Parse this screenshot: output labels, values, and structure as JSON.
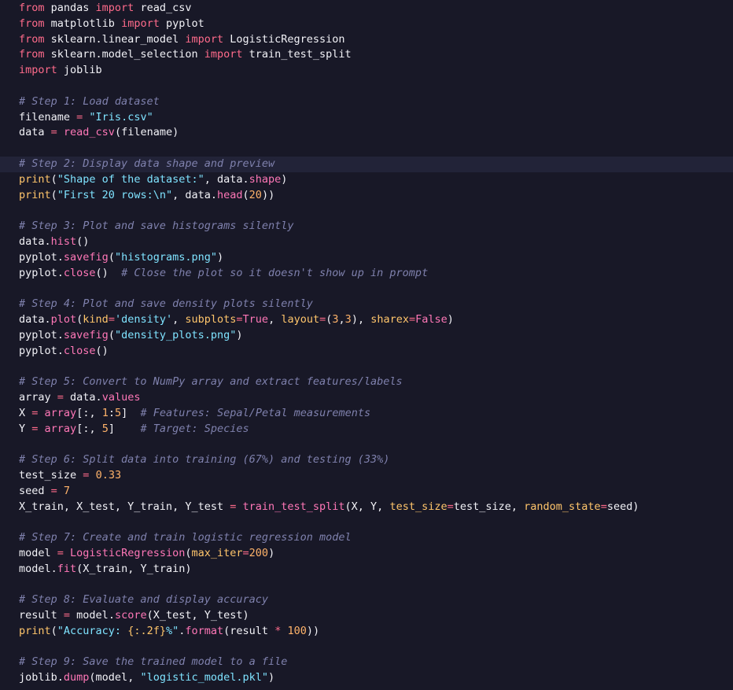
{
  "editor": {
    "lines": [
      [
        {
          "t": "from",
          "c": "kw"
        },
        {
          "t": " pandas ",
          "c": "id"
        },
        {
          "t": "import",
          "c": "kw"
        },
        {
          "t": " read_csv",
          "c": "id"
        }
      ],
      [
        {
          "t": "from",
          "c": "kw"
        },
        {
          "t": " matplotlib ",
          "c": "id"
        },
        {
          "t": "import",
          "c": "kw"
        },
        {
          "t": " pyplot",
          "c": "id"
        }
      ],
      [
        {
          "t": "from",
          "c": "kw"
        },
        {
          "t": " sklearn.linear_model ",
          "c": "id"
        },
        {
          "t": "import",
          "c": "kw"
        },
        {
          "t": " LogisticRegression",
          "c": "id"
        }
      ],
      [
        {
          "t": "from",
          "c": "kw"
        },
        {
          "t": " sklearn.model_selection ",
          "c": "id"
        },
        {
          "t": "import",
          "c": "kw"
        },
        {
          "t": " train_test_split",
          "c": "id"
        }
      ],
      [
        {
          "t": "import",
          "c": "kw"
        },
        {
          "t": " joblib",
          "c": "id"
        }
      ],
      [],
      [
        {
          "t": "# Step 1: Load dataset",
          "c": "cm"
        }
      ],
      [
        {
          "t": "filename ",
          "c": "id"
        },
        {
          "t": "=",
          "c": "op"
        },
        {
          "t": " \"Iris.csv\"",
          "c": "str"
        }
      ],
      [
        {
          "t": "data ",
          "c": "id"
        },
        {
          "t": "=",
          "c": "op"
        },
        {
          "t": " read_csv",
          "c": "fn"
        },
        {
          "t": "(filename)",
          "c": "pun"
        }
      ],
      [],
      [
        {
          "t": "# Step 2: Display data shape and preview",
          "c": "cm"
        }
      ],
      [
        {
          "t": "print",
          "c": "param"
        },
        {
          "t": "(",
          "c": "pun"
        },
        {
          "t": "\"Shape of the dataset:\"",
          "c": "str"
        },
        {
          "t": ", data.",
          "c": "pun"
        },
        {
          "t": "shape",
          "c": "fn"
        },
        {
          "t": ")",
          "c": "pun"
        }
      ],
      [
        {
          "t": "print",
          "c": "param"
        },
        {
          "t": "(",
          "c": "pun"
        },
        {
          "t": "\"First 20 rows:",
          "c": "str"
        },
        {
          "t": "\\n",
          "c": "esc"
        },
        {
          "t": "\"",
          "c": "str"
        },
        {
          "t": ", data.",
          "c": "pun"
        },
        {
          "t": "head",
          "c": "fn"
        },
        {
          "t": "(",
          "c": "pun"
        },
        {
          "t": "20",
          "c": "num"
        },
        {
          "t": "))",
          "c": "pun"
        }
      ],
      [],
      [
        {
          "t": "# Step 3: Plot and save histograms silently",
          "c": "cm"
        }
      ],
      [
        {
          "t": "data.",
          "c": "id"
        },
        {
          "t": "hist",
          "c": "fn"
        },
        {
          "t": "()",
          "c": "pun"
        }
      ],
      [
        {
          "t": "pyplot.",
          "c": "id"
        },
        {
          "t": "savefig",
          "c": "fn"
        },
        {
          "t": "(",
          "c": "pun"
        },
        {
          "t": "\"histograms.png\"",
          "c": "str"
        },
        {
          "t": ")",
          "c": "pun"
        }
      ],
      [
        {
          "t": "pyplot.",
          "c": "id"
        },
        {
          "t": "close",
          "c": "fn"
        },
        {
          "t": "()  ",
          "c": "pun"
        },
        {
          "t": "# Close the plot so it doesn't show up in prompt",
          "c": "cm"
        }
      ],
      [],
      [
        {
          "t": "# Step 4: Plot and save density plots silently",
          "c": "cm"
        }
      ],
      [
        {
          "t": "data.",
          "c": "id"
        },
        {
          "t": "plot",
          "c": "fn"
        },
        {
          "t": "(",
          "c": "pun"
        },
        {
          "t": "kind",
          "c": "param"
        },
        {
          "t": "=",
          "c": "op"
        },
        {
          "t": "'density'",
          "c": "str"
        },
        {
          "t": ", ",
          "c": "pun"
        },
        {
          "t": "subplots",
          "c": "param"
        },
        {
          "t": "=",
          "c": "op"
        },
        {
          "t": "True",
          "c": "bool"
        },
        {
          "t": ", ",
          "c": "pun"
        },
        {
          "t": "layout",
          "c": "param"
        },
        {
          "t": "=",
          "c": "op"
        },
        {
          "t": "(",
          "c": "pun"
        },
        {
          "t": "3",
          "c": "num"
        },
        {
          "t": ",",
          "c": "pun"
        },
        {
          "t": "3",
          "c": "num"
        },
        {
          "t": "), ",
          "c": "pun"
        },
        {
          "t": "sharex",
          "c": "param"
        },
        {
          "t": "=",
          "c": "op"
        },
        {
          "t": "False",
          "c": "bool"
        },
        {
          "t": ")",
          "c": "pun"
        }
      ],
      [
        {
          "t": "pyplot.",
          "c": "id"
        },
        {
          "t": "savefig",
          "c": "fn"
        },
        {
          "t": "(",
          "c": "pun"
        },
        {
          "t": "\"density_plots.png\"",
          "c": "str"
        },
        {
          "t": ")",
          "c": "pun"
        }
      ],
      [
        {
          "t": "pyplot.",
          "c": "id"
        },
        {
          "t": "close",
          "c": "fn"
        },
        {
          "t": "()",
          "c": "pun"
        }
      ],
      [],
      [
        {
          "t": "# Step 5: Convert to NumPy array and extract features/labels",
          "c": "cm"
        }
      ],
      [
        {
          "t": "array ",
          "c": "id"
        },
        {
          "t": "=",
          "c": "op"
        },
        {
          "t": " data.",
          "c": "id"
        },
        {
          "t": "values",
          "c": "fn"
        }
      ],
      [
        {
          "t": "X ",
          "c": "id"
        },
        {
          "t": "=",
          "c": "op"
        },
        {
          "t": " array",
          "c": "fn"
        },
        {
          "t": "[:, ",
          "c": "pun"
        },
        {
          "t": "1",
          "c": "num"
        },
        {
          "t": ":",
          "c": "pun"
        },
        {
          "t": "5",
          "c": "num"
        },
        {
          "t": "]  ",
          "c": "pun"
        },
        {
          "t": "# Features: Sepal/Petal measurements",
          "c": "cm"
        }
      ],
      [
        {
          "t": "Y ",
          "c": "id"
        },
        {
          "t": "=",
          "c": "op"
        },
        {
          "t": " array",
          "c": "fn"
        },
        {
          "t": "[:, ",
          "c": "pun"
        },
        {
          "t": "5",
          "c": "num"
        },
        {
          "t": "]    ",
          "c": "pun"
        },
        {
          "t": "# Target: Species",
          "c": "cm"
        }
      ],
      [],
      [
        {
          "t": "# Step 6: Split data into training (67%) and testing (33%)",
          "c": "cm"
        }
      ],
      [
        {
          "t": "test_size ",
          "c": "id"
        },
        {
          "t": "=",
          "c": "op"
        },
        {
          "t": " ",
          "c": "pun"
        },
        {
          "t": "0.33",
          "c": "num"
        }
      ],
      [
        {
          "t": "seed ",
          "c": "id"
        },
        {
          "t": "=",
          "c": "op"
        },
        {
          "t": " ",
          "c": "pun"
        },
        {
          "t": "7",
          "c": "num"
        }
      ],
      [
        {
          "t": "X_train, X_test, Y_train, Y_test ",
          "c": "id"
        },
        {
          "t": "=",
          "c": "op"
        },
        {
          "t": " train_test_split",
          "c": "fn"
        },
        {
          "t": "(X, Y, ",
          "c": "pun"
        },
        {
          "t": "test_size",
          "c": "param"
        },
        {
          "t": "=",
          "c": "op"
        },
        {
          "t": "test_size, ",
          "c": "pun"
        },
        {
          "t": "random_state",
          "c": "param"
        },
        {
          "t": "=",
          "c": "op"
        },
        {
          "t": "seed)",
          "c": "pun"
        }
      ],
      [],
      [
        {
          "t": "# Step 7: Create and train logistic regression model",
          "c": "cm"
        }
      ],
      [
        {
          "t": "model ",
          "c": "id"
        },
        {
          "t": "=",
          "c": "op"
        },
        {
          "t": " LogisticRegression",
          "c": "fn"
        },
        {
          "t": "(",
          "c": "pun"
        },
        {
          "t": "max_iter",
          "c": "param"
        },
        {
          "t": "=",
          "c": "op"
        },
        {
          "t": "200",
          "c": "num"
        },
        {
          "t": ")",
          "c": "pun"
        }
      ],
      [
        {
          "t": "model.",
          "c": "id"
        },
        {
          "t": "fit",
          "c": "fn"
        },
        {
          "t": "(X_train, Y_train)",
          "c": "pun"
        }
      ],
      [],
      [
        {
          "t": "# Step 8: Evaluate and display accuracy",
          "c": "cm"
        }
      ],
      [
        {
          "t": "result ",
          "c": "id"
        },
        {
          "t": "=",
          "c": "op"
        },
        {
          "t": " model.",
          "c": "id"
        },
        {
          "t": "score",
          "c": "fn"
        },
        {
          "t": "(X_test, Y_test)",
          "c": "pun"
        }
      ],
      [
        {
          "t": "print",
          "c": "param"
        },
        {
          "t": "(",
          "c": "pun"
        },
        {
          "t": "\"Accuracy: ",
          "c": "str"
        },
        {
          "t": "{:.2f}",
          "c": "param"
        },
        {
          "t": "%\"",
          "c": "str"
        },
        {
          "t": ".",
          "c": "pun"
        },
        {
          "t": "format",
          "c": "fn"
        },
        {
          "t": "(result ",
          "c": "pun"
        },
        {
          "t": "*",
          "c": "op"
        },
        {
          "t": " ",
          "c": "pun"
        },
        {
          "t": "100",
          "c": "num"
        },
        {
          "t": "))",
          "c": "pun"
        }
      ],
      [],
      [
        {
          "t": "# Step 9: Save the trained model to a file",
          "c": "cm"
        }
      ],
      [
        {
          "t": "joblib.",
          "c": "id"
        },
        {
          "t": "dump",
          "c": "fn"
        },
        {
          "t": "(model, ",
          "c": "pun"
        },
        {
          "t": "\"logistic_model.pkl\"",
          "c": "str"
        },
        {
          "t": ")",
          "c": "pun"
        }
      ]
    ],
    "active_line_index": 10,
    "colors": {
      "background": "#181827",
      "active_line_bg": "#222338",
      "keyword": "#ff6b8b",
      "function": "#ff77b7",
      "string": "#7fe3ff",
      "number": "#ffb36a",
      "comment": "#7f81ad",
      "param": "#ffc56b",
      "text": "#f2f2f7"
    }
  }
}
